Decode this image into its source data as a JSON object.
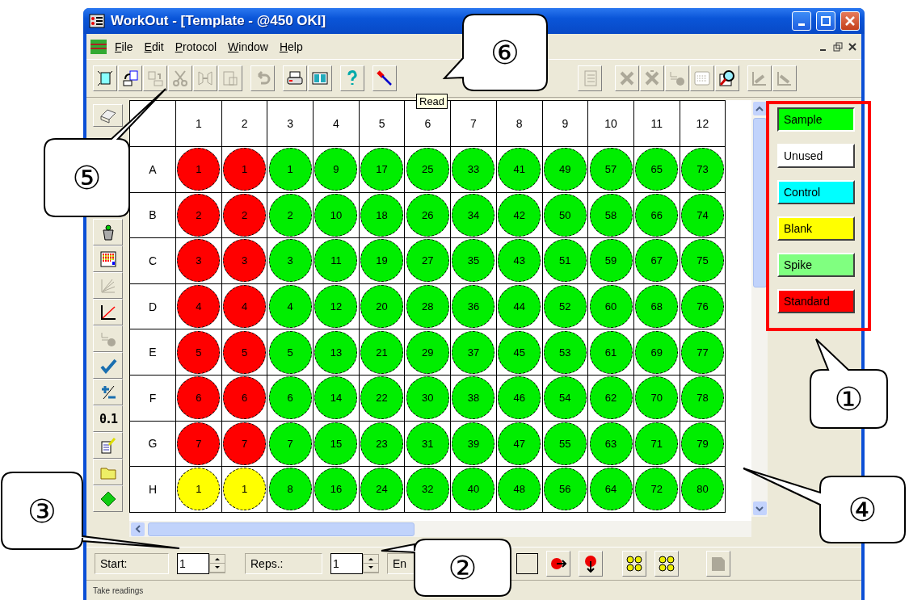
{
  "window": {
    "title": "WorkOut - [Template - @450 OKI]"
  },
  "menu": [
    "File",
    "Edit",
    "Protocol",
    "Window",
    "Help"
  ],
  "tooltip": "Read",
  "decimal_button": "0.1",
  "plate": {
    "columns": [
      "1",
      "2",
      "3",
      "4",
      "5",
      "6",
      "7",
      "8",
      "9",
      "10",
      "11",
      "12"
    ],
    "rows": [
      {
        "label": "A",
        "wells": [
          {
            "label": "1",
            "kind": "standard"
          },
          {
            "label": "1",
            "kind": "standard"
          },
          {
            "label": "1",
            "kind": "sample"
          },
          {
            "label": "9",
            "kind": "sample"
          },
          {
            "label": "17",
            "kind": "sample"
          },
          {
            "label": "25",
            "kind": "sample"
          },
          {
            "label": "33",
            "kind": "sample"
          },
          {
            "label": "41",
            "kind": "sample"
          },
          {
            "label": "49",
            "kind": "sample"
          },
          {
            "label": "57",
            "kind": "sample"
          },
          {
            "label": "65",
            "kind": "sample"
          },
          {
            "label": "73",
            "kind": "sample"
          }
        ]
      },
      {
        "label": "B",
        "wells": [
          {
            "label": "2",
            "kind": "standard"
          },
          {
            "label": "2",
            "kind": "standard"
          },
          {
            "label": "2",
            "kind": "sample"
          },
          {
            "label": "10",
            "kind": "sample"
          },
          {
            "label": "18",
            "kind": "sample"
          },
          {
            "label": "26",
            "kind": "sample"
          },
          {
            "label": "34",
            "kind": "sample"
          },
          {
            "label": "42",
            "kind": "sample"
          },
          {
            "label": "50",
            "kind": "sample"
          },
          {
            "label": "58",
            "kind": "sample"
          },
          {
            "label": "66",
            "kind": "sample"
          },
          {
            "label": "74",
            "kind": "sample"
          }
        ]
      },
      {
        "label": "C",
        "wells": [
          {
            "label": "3",
            "kind": "standard"
          },
          {
            "label": "3",
            "kind": "standard"
          },
          {
            "label": "3",
            "kind": "sample"
          },
          {
            "label": "11",
            "kind": "sample"
          },
          {
            "label": "19",
            "kind": "sample"
          },
          {
            "label": "27",
            "kind": "sample"
          },
          {
            "label": "35",
            "kind": "sample"
          },
          {
            "label": "43",
            "kind": "sample"
          },
          {
            "label": "51",
            "kind": "sample"
          },
          {
            "label": "59",
            "kind": "sample"
          },
          {
            "label": "67",
            "kind": "sample"
          },
          {
            "label": "75",
            "kind": "sample"
          }
        ]
      },
      {
        "label": "D",
        "wells": [
          {
            "label": "4",
            "kind": "standard"
          },
          {
            "label": "4",
            "kind": "standard"
          },
          {
            "label": "4",
            "kind": "sample"
          },
          {
            "label": "12",
            "kind": "sample"
          },
          {
            "label": "20",
            "kind": "sample"
          },
          {
            "label": "28",
            "kind": "sample"
          },
          {
            "label": "36",
            "kind": "sample"
          },
          {
            "label": "44",
            "kind": "sample"
          },
          {
            "label": "52",
            "kind": "sample"
          },
          {
            "label": "60",
            "kind": "sample"
          },
          {
            "label": "68",
            "kind": "sample"
          },
          {
            "label": "76",
            "kind": "sample"
          }
        ]
      },
      {
        "label": "E",
        "wells": [
          {
            "label": "5",
            "kind": "standard"
          },
          {
            "label": "5",
            "kind": "standard"
          },
          {
            "label": "5",
            "kind": "sample"
          },
          {
            "label": "13",
            "kind": "sample"
          },
          {
            "label": "21",
            "kind": "sample"
          },
          {
            "label": "29",
            "kind": "sample"
          },
          {
            "label": "37",
            "kind": "sample"
          },
          {
            "label": "45",
            "kind": "sample"
          },
          {
            "label": "53",
            "kind": "sample"
          },
          {
            "label": "61",
            "kind": "sample"
          },
          {
            "label": "69",
            "kind": "sample"
          },
          {
            "label": "77",
            "kind": "sample"
          }
        ]
      },
      {
        "label": "F",
        "wells": [
          {
            "label": "6",
            "kind": "standard"
          },
          {
            "label": "6",
            "kind": "standard"
          },
          {
            "label": "6",
            "kind": "sample"
          },
          {
            "label": "14",
            "kind": "sample"
          },
          {
            "label": "22",
            "kind": "sample"
          },
          {
            "label": "30",
            "kind": "sample"
          },
          {
            "label": "38",
            "kind": "sample"
          },
          {
            "label": "46",
            "kind": "sample"
          },
          {
            "label": "54",
            "kind": "sample"
          },
          {
            "label": "62",
            "kind": "sample"
          },
          {
            "label": "70",
            "kind": "sample"
          },
          {
            "label": "78",
            "kind": "sample"
          }
        ]
      },
      {
        "label": "G",
        "wells": [
          {
            "label": "7",
            "kind": "standard"
          },
          {
            "label": "7",
            "kind": "standard"
          },
          {
            "label": "7",
            "kind": "sample"
          },
          {
            "label": "15",
            "kind": "sample"
          },
          {
            "label": "23",
            "kind": "sample"
          },
          {
            "label": "31",
            "kind": "sample"
          },
          {
            "label": "39",
            "kind": "sample"
          },
          {
            "label": "47",
            "kind": "sample"
          },
          {
            "label": "55",
            "kind": "sample"
          },
          {
            "label": "63",
            "kind": "sample"
          },
          {
            "label": "71",
            "kind": "sample"
          },
          {
            "label": "79",
            "kind": "sample"
          }
        ]
      },
      {
        "label": "H",
        "wells": [
          {
            "label": "1",
            "kind": "blank"
          },
          {
            "label": "1",
            "kind": "blank"
          },
          {
            "label": "8",
            "kind": "sample"
          },
          {
            "label": "16",
            "kind": "sample"
          },
          {
            "label": "24",
            "kind": "sample"
          },
          {
            "label": "32",
            "kind": "sample"
          },
          {
            "label": "40",
            "kind": "sample"
          },
          {
            "label": "48",
            "kind": "sample"
          },
          {
            "label": "56",
            "kind": "sample"
          },
          {
            "label": "64",
            "kind": "sample"
          },
          {
            "label": "72",
            "kind": "sample"
          },
          {
            "label": "80",
            "kind": "sample"
          }
        ]
      }
    ]
  },
  "legend": [
    {
      "label": "Sample",
      "color": "#00ff00",
      "selected": true
    },
    {
      "label": "Unused",
      "color": "#ffffff",
      "selected": false
    },
    {
      "label": "Control",
      "color": "#00ffff",
      "selected": false
    },
    {
      "label": "Blank",
      "color": "#ffff00",
      "selected": false
    },
    {
      "label": "Spike",
      "color": "#80ff80",
      "selected": false
    },
    {
      "label": "Standard",
      "color": "#ff0000",
      "selected": false
    }
  ],
  "bottom_bar": {
    "start": {
      "label": "Start:",
      "value": "1"
    },
    "reps": {
      "label": "Reps.:",
      "value": "1"
    },
    "end": {
      "label": "En"
    }
  },
  "status_bar": "Take readings",
  "callouts": [
    "⑥",
    "⑤",
    "③",
    "②",
    "①",
    "④"
  ]
}
